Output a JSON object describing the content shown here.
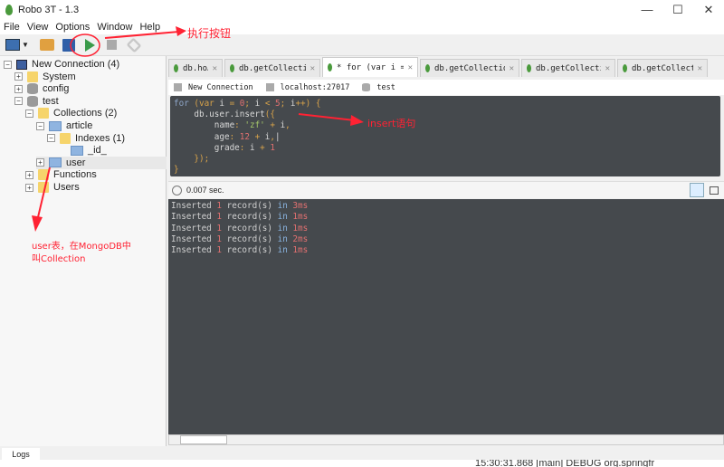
{
  "window": {
    "title": "Robo 3T - 1.3",
    "controls": [
      "—",
      "☐",
      "✕"
    ]
  },
  "menu": [
    "File",
    "View",
    "Options",
    "Window",
    "Help"
  ],
  "toolbar": {
    "icons": [
      "connect-icon",
      "open-icon",
      "save-icon",
      "execute-icon",
      "stop-icon",
      "format-icon"
    ]
  },
  "tree": [
    {
      "label": "New Connection (4)",
      "icon": "server",
      "depth": 0,
      "exp": "−"
    },
    {
      "label": "System",
      "icon": "folder",
      "depth": 1,
      "exp": "+"
    },
    {
      "label": "config",
      "icon": "db",
      "depth": 1,
      "exp": "+"
    },
    {
      "label": "test",
      "icon": "db",
      "depth": 1,
      "exp": "−"
    },
    {
      "label": "Collections (2)",
      "icon": "folder",
      "depth": 2,
      "exp": "−"
    },
    {
      "label": "article",
      "icon": "coll",
      "depth": 3,
      "exp": "−"
    },
    {
      "label": "Indexes (1)",
      "icon": "folder",
      "depth": 4,
      "exp": "−"
    },
    {
      "label": "_id_",
      "icon": "index",
      "depth": 5,
      "exp": ""
    },
    {
      "label": "user",
      "icon": "coll",
      "depth": 3,
      "exp": "+",
      "selected": true
    },
    {
      "label": "Functions",
      "icon": "folder",
      "depth": 2,
      "exp": "+"
    },
    {
      "label": "Users",
      "icon": "folder",
      "depth": 2,
      "exp": "+"
    }
  ],
  "tabs": [
    {
      "label": "db.ho…",
      "w": 60
    },
    {
      "label": "db.getCollection…",
      "w": 106
    },
    {
      "label": "* for (var i = 0…",
      "w": 106,
      "active": true
    },
    {
      "label": "db.getCollection…",
      "w": 110
    },
    {
      "label": "db.getCollection…",
      "w": 104
    },
    {
      "label": "db.getCollection(…",
      "w": 100
    }
  ],
  "breadcrumb": {
    "connection": "New Connection",
    "host": "localhost:27017",
    "database": "test"
  },
  "editor": {
    "lines": [
      [
        [
          "kw",
          "for "
        ],
        [
          "pn",
          "(var "
        ],
        [
          "",
          "i "
        ],
        [
          "pn",
          "= "
        ],
        [
          "nm",
          "0"
        ],
        [
          "pn",
          "; "
        ],
        [
          "",
          "i "
        ],
        [
          "pn",
          "< "
        ],
        [
          "nm",
          "5"
        ],
        [
          "pn",
          "; "
        ],
        [
          "",
          "i"
        ],
        [
          "pn",
          "++) {"
        ]
      ],
      [
        [
          "",
          "    db.user.insert"
        ],
        [
          "pn",
          "({"
        ]
      ],
      [
        [
          "",
          "        name"
        ],
        [
          "pn",
          ": "
        ],
        [
          "st",
          "'zf'"
        ],
        [
          "pn",
          " + "
        ],
        [
          "",
          "i"
        ],
        [
          "pn",
          ","
        ]
      ],
      [
        [
          "",
          "        age"
        ],
        [
          "pn",
          ": "
        ],
        [
          "nm",
          "12"
        ],
        [
          "pn",
          " + "
        ],
        [
          "",
          "i"
        ],
        [
          "pn",
          ","
        ],
        [
          "",
          "|"
        ]
      ],
      [
        [
          "",
          "        grade"
        ],
        [
          "pn",
          ": "
        ],
        [
          "",
          "i "
        ],
        [
          "pn",
          "+ "
        ],
        [
          "nm",
          "1"
        ]
      ],
      [
        [
          "pn",
          "    });"
        ]
      ],
      [
        [
          "pn",
          "}"
        ]
      ]
    ]
  },
  "status": {
    "time": "0.007 sec."
  },
  "output": [
    {
      "prefix": "Inserted",
      "count": "1",
      "mid": "record(s)",
      "in": "in",
      "time": "3ms"
    },
    {
      "prefix": "Inserted",
      "count": "1",
      "mid": "record(s)",
      "in": "in",
      "time": "1ms"
    },
    {
      "prefix": "Inserted",
      "count": "1",
      "mid": "record(s)",
      "in": "in",
      "time": "1ms"
    },
    {
      "prefix": "Inserted",
      "count": "1",
      "mid": "record(s)",
      "in": "in",
      "time": "2ms"
    },
    {
      "prefix": "Inserted",
      "count": "1",
      "mid": "record(s)",
      "in": "in",
      "time": "1ms"
    }
  ],
  "logs_tab": "Logs",
  "background_text": "15:30:31.868 [main] DEBUG org.springfr",
  "annotations": {
    "execute": "执行按钮",
    "insert": "insert语句",
    "user_line1": "user表，在MongoDB中",
    "user_line2": "叫Collection"
  },
  "colors": {
    "editor_bg": "#45494d",
    "annotation": "#ff2233",
    "accent_green": "#4a9a3c"
  }
}
